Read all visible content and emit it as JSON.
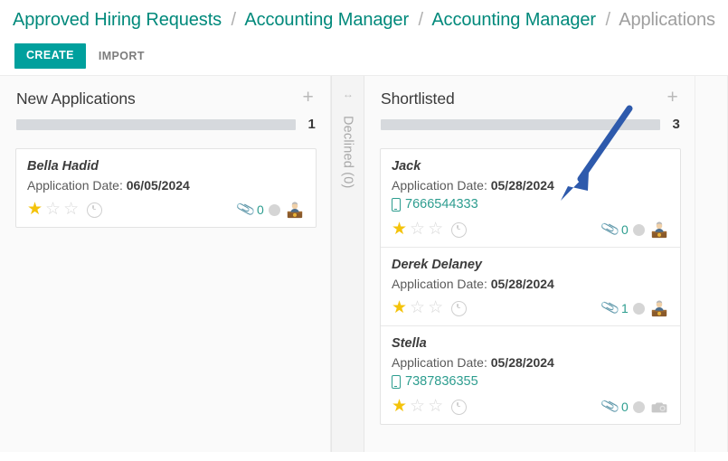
{
  "breadcrumb": {
    "items": [
      {
        "label": "Approved Hiring Requests",
        "current": false
      },
      {
        "label": "Accounting Manager",
        "current": false
      },
      {
        "label": "Accounting Manager",
        "current": false
      },
      {
        "label": "Applications",
        "current": true
      }
    ],
    "separator": "/"
  },
  "toolbar": {
    "create_label": "CREATE",
    "import_label": "IMPORT"
  },
  "colors": {
    "accent_teal": "#00a09d",
    "link_teal": "#00897b",
    "star_gold": "#f4c30b",
    "annotation_blue": "#2e5aac",
    "column_bg": "#fafafa",
    "progress_bar": "#d6d9dd"
  },
  "annotation": {
    "type": "arrow",
    "color": "#2e5aac",
    "points_to": "shortlisted-progress-bar"
  },
  "columns": [
    {
      "title": "New Applications",
      "count": "1",
      "add_icon": "plus-icon",
      "cards": [
        {
          "name": "Bella Hadid",
          "date_label": "Application Date:",
          "date_value": "06/05/2024",
          "phone": "",
          "stars_filled": 1,
          "stars_total": 3,
          "clock_icon": "clock-icon",
          "attachment_count": "0",
          "avatar_type": "office-worker"
        }
      ]
    },
    {
      "title": "Shortlisted",
      "count": "3",
      "add_icon": "plus-icon",
      "cards": [
        {
          "name": "Jack",
          "date_label": "Application Date:",
          "date_value": "05/28/2024",
          "phone": "7666544333",
          "stars_filled": 1,
          "stars_total": 3,
          "clock_icon": "clock-icon",
          "attachment_count": "0",
          "avatar_type": "office-worker"
        },
        {
          "name": "Derek Delaney",
          "date_label": "Application Date:",
          "date_value": "05/28/2024",
          "phone": "",
          "stars_filled": 1,
          "stars_total": 3,
          "clock_icon": "clock-icon",
          "attachment_count": "1",
          "avatar_type": "office-worker"
        },
        {
          "name": "Stella",
          "date_label": "Application Date:",
          "date_value": "05/28/2024",
          "phone": "7387836355",
          "stars_filled": 1,
          "stars_total": 3,
          "clock_icon": "clock-icon",
          "attachment_count": "0",
          "avatar_type": "placeholder-camera"
        }
      ]
    }
  ],
  "collapsed_column": {
    "label": "Declined (0)",
    "expand_icon": "horizontal-arrows-icon"
  }
}
